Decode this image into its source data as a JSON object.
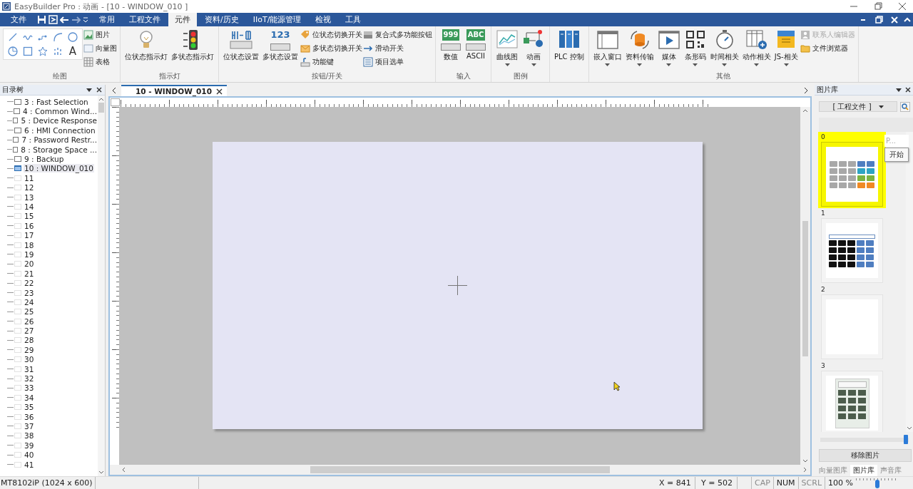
{
  "window": {
    "title": "EasyBuilder Pro : 动画 - [10 - WINDOW_010 ]"
  },
  "menu_tabs": [
    {
      "label": "文件",
      "selected": false,
      "kind": "file"
    },
    {
      "label": "常用",
      "selected": false,
      "kind": "tab"
    },
    {
      "label": "工程文件",
      "selected": false,
      "kind": "tab"
    },
    {
      "label": "元件",
      "selected": true,
      "kind": "tab"
    },
    {
      "label": "资料/历史",
      "selected": false,
      "kind": "tab"
    },
    {
      "label": "IIoT/能源管理",
      "selected": false,
      "kind": "tab"
    },
    {
      "label": "检视",
      "selected": false,
      "kind": "tab"
    },
    {
      "label": "工具",
      "selected": false,
      "kind": "tab"
    }
  ],
  "ribbon": {
    "groups": [
      {
        "label": "绘图",
        "text_tool_glyph": "A",
        "items": [
          {
            "kind": "small",
            "label": "图片",
            "disabled": false
          },
          {
            "kind": "small",
            "label": "向量图",
            "disabled": false
          },
          {
            "kind": "small",
            "label": "表格",
            "disabled": false
          }
        ]
      },
      {
        "label": "指示灯",
        "items": [
          {
            "kind": "large",
            "label": "位状态指示灯",
            "dropdown": false,
            "disabled": false
          },
          {
            "kind": "large",
            "label": "多状态指示灯",
            "dropdown": false,
            "disabled": false
          }
        ]
      },
      {
        "label": "按钮/开关",
        "items": [
          {
            "kind": "large",
            "label": "位状态设置",
            "dropdown": false,
            "disabled": false
          },
          {
            "kind": "large",
            "label": "多状态设置",
            "icon_text": "123",
            "dropdown": false,
            "disabled": false
          },
          {
            "kind": "small",
            "label": "位状态切换开关",
            "disabled": false
          },
          {
            "kind": "small",
            "label": "多状态切换开关",
            "disabled": false
          },
          {
            "kind": "small",
            "label": "功能键",
            "disabled": false
          },
          {
            "kind": "small",
            "label": "复合式多功能按钮",
            "disabled": false
          },
          {
            "kind": "small",
            "label": "滑动开关",
            "disabled": false
          },
          {
            "kind": "small",
            "label": "项目选单",
            "disabled": false
          }
        ]
      },
      {
        "label": "输入",
        "items": [
          {
            "kind": "large",
            "label": "数值",
            "icon_text": "999",
            "dropdown": false,
            "disabled": false
          },
          {
            "kind": "large",
            "label": "ASCII",
            "icon_text": "ABC",
            "dropdown": false,
            "disabled": false
          }
        ]
      },
      {
        "label": "图例",
        "items": [
          {
            "kind": "large",
            "label": "曲线图",
            "dropdown": true,
            "disabled": false
          },
          {
            "kind": "large",
            "label": "动画",
            "dropdown": true,
            "disabled": false
          }
        ]
      },
      {
        "items": [
          {
            "kind": "large",
            "label": "PLC 控制",
            "dropdown": false,
            "disabled": false
          }
        ]
      },
      {
        "label": "其他",
        "items": [
          {
            "kind": "large",
            "label": "嵌入窗口",
            "dropdown": true,
            "disabled": false
          },
          {
            "kind": "large",
            "label": "资料传输",
            "dropdown": true,
            "disabled": false
          },
          {
            "kind": "large",
            "label": "媒体",
            "dropdown": true,
            "disabled": false
          },
          {
            "kind": "large",
            "label": "条形码",
            "dropdown": true,
            "disabled": false
          },
          {
            "kind": "large",
            "label": "时间相关",
            "dropdown": true,
            "disabled": false
          },
          {
            "kind": "large",
            "label": "动作相关",
            "dropdown": true,
            "disabled": false
          },
          {
            "kind": "large",
            "label": "JS-相关",
            "dropdown": true,
            "disabled": false
          },
          {
            "kind": "small",
            "label": "联系人编辑器",
            "disabled": true
          },
          {
            "kind": "small",
            "label": "文件浏览器",
            "disabled": false
          }
        ]
      }
    ]
  },
  "tree": {
    "title": "目录树",
    "items": [
      {
        "label": "3 : Fast Selection",
        "defined": true,
        "selected": false
      },
      {
        "label": "4 : Common Wind...",
        "defined": true,
        "selected": false
      },
      {
        "label": "5 : Device Response",
        "defined": true,
        "selected": false
      },
      {
        "label": "6 : HMI Connection",
        "defined": true,
        "selected": false
      },
      {
        "label": "7 : Password Restr...",
        "defined": true,
        "selected": false
      },
      {
        "label": "8 : Storage Space ...",
        "defined": true,
        "selected": false
      },
      {
        "label": "9 : Backup",
        "defined": true,
        "selected": false
      },
      {
        "label": "10 : WINDOW_010",
        "defined": true,
        "selected": true
      },
      {
        "label": "11",
        "defined": false,
        "selected": false
      },
      {
        "label": "12",
        "defined": false,
        "selected": false
      },
      {
        "label": "13",
        "defined": false,
        "selected": false
      },
      {
        "label": "14",
        "defined": false,
        "selected": false
      },
      {
        "label": "15",
        "defined": false,
        "selected": false
      },
      {
        "label": "16",
        "defined": false,
        "selected": false
      },
      {
        "label": "17",
        "defined": false,
        "selected": false
      },
      {
        "label": "18",
        "defined": false,
        "selected": false
      },
      {
        "label": "19",
        "defined": false,
        "selected": false
      },
      {
        "label": "20",
        "defined": false,
        "selected": false
      },
      {
        "label": "21",
        "defined": false,
        "selected": false
      },
      {
        "label": "22",
        "defined": false,
        "selected": false
      },
      {
        "label": "23",
        "defined": false,
        "selected": false
      },
      {
        "label": "24",
        "defined": false,
        "selected": false
      },
      {
        "label": "25",
        "defined": false,
        "selected": false
      },
      {
        "label": "26",
        "defined": false,
        "selected": false
      },
      {
        "label": "27",
        "defined": false,
        "selected": false
      },
      {
        "label": "28",
        "defined": false,
        "selected": false
      },
      {
        "label": "29",
        "defined": false,
        "selected": false
      },
      {
        "label": "30",
        "defined": false,
        "selected": false
      },
      {
        "label": "31",
        "defined": false,
        "selected": false
      },
      {
        "label": "32",
        "defined": false,
        "selected": false
      },
      {
        "label": "33",
        "defined": false,
        "selected": false
      },
      {
        "label": "34",
        "defined": false,
        "selected": false
      },
      {
        "label": "35",
        "defined": false,
        "selected": false
      },
      {
        "label": "36",
        "defined": false,
        "selected": false
      },
      {
        "label": "37",
        "defined": false,
        "selected": false
      },
      {
        "label": "38",
        "defined": false,
        "selected": false
      },
      {
        "label": "39",
        "defined": false,
        "selected": false
      },
      {
        "label": "40",
        "defined": false,
        "selected": false
      },
      {
        "label": "41",
        "defined": false,
        "selected": false
      }
    ]
  },
  "editor": {
    "tabs": [
      {
        "label": "10 - WINDOW_010",
        "selected": true
      }
    ]
  },
  "library": {
    "title": "图片库",
    "source": "[ 工程文件 ]",
    "pictures": [
      {
        "label": "0",
        "selected": true,
        "kind": "keypad"
      },
      {
        "label": "1",
        "selected": false,
        "kind": "numpad"
      },
      {
        "label": "2",
        "selected": false,
        "kind": "blank"
      },
      {
        "label": "3",
        "selected": false,
        "kind": "calculator"
      }
    ],
    "tooltip": "P...",
    "popup_item": "开始",
    "size_slider": {
      "level": 0.97
    },
    "remove_button": "移除图片",
    "tabs": [
      {
        "label": "向量图库",
        "selected": false
      },
      {
        "label": "图片库",
        "selected": true
      },
      {
        "label": "声音库",
        "selected": false
      }
    ]
  },
  "status_bar": {
    "model": "MT8102iP (1024 x 600)",
    "x": "X = 841",
    "y": "Y = 502",
    "keys": [
      {
        "label": "CAP",
        "on": false
      },
      {
        "label": "NUM",
        "on": true
      },
      {
        "label": "SCRL",
        "on": false
      }
    ],
    "zoom": "100 %",
    "zoom_slider": {
      "level": 0.5
    }
  }
}
